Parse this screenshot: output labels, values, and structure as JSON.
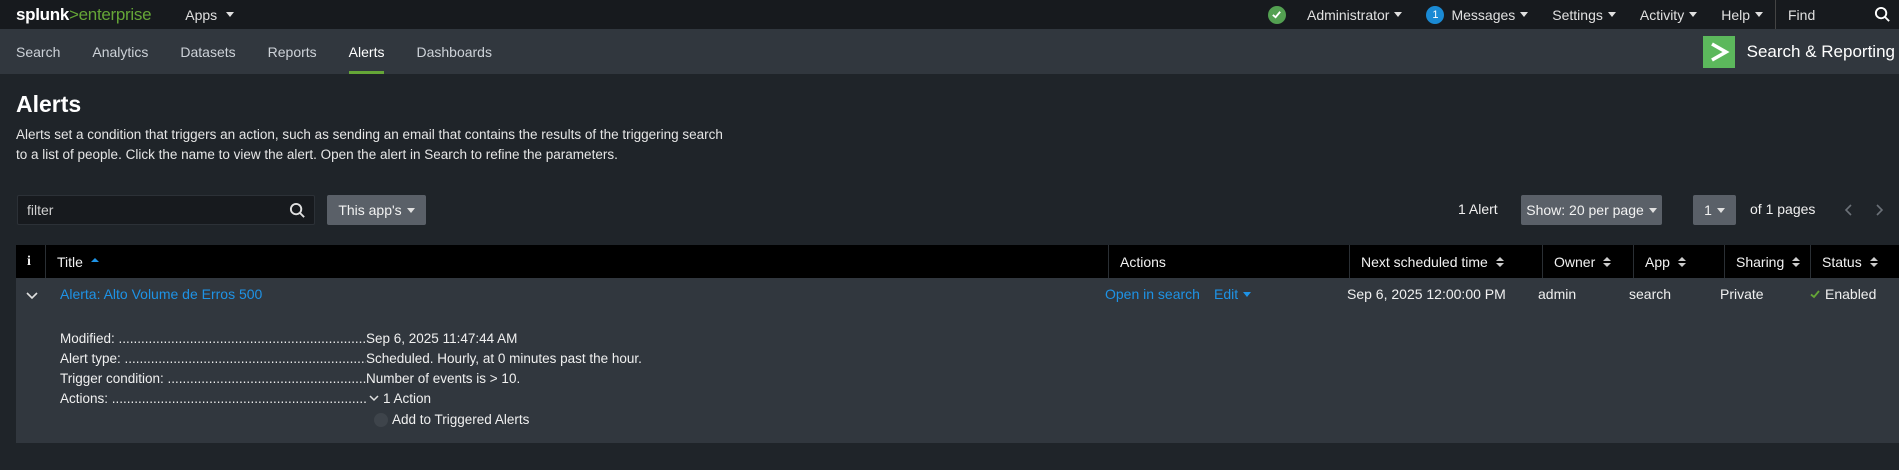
{
  "topbar": {
    "logo_main": "splunk",
    "logo_gt": ">",
    "logo_suffix": "enterprise",
    "apps_label": "Apps",
    "admin_label": "Administrator",
    "messages_count": "1",
    "messages_label": "Messages",
    "settings_label": "Settings",
    "activity_label": "Activity",
    "help_label": "Help",
    "find_label": "Find"
  },
  "appbar": {
    "nav": [
      "Search",
      "Analytics",
      "Datasets",
      "Reports",
      "Alerts",
      "Dashboards"
    ],
    "app_title": "Search & Reporting"
  },
  "page": {
    "title": "Alerts",
    "description": "Alerts set a condition that triggers an action, such as sending an email that contains the results of the triggering search to a list of people. Click the name to view the alert. Open the alert in Search to refine the parameters."
  },
  "controls": {
    "filter_placeholder": "filter",
    "apps_button": "This app's",
    "alert_count": "1 Alert",
    "per_page": "Show: 20 per page",
    "page_number": "1",
    "of_pages": "of 1 pages"
  },
  "table": {
    "headers": {
      "info": "i",
      "title": "Title",
      "actions": "Actions",
      "next_time": "Next scheduled time",
      "owner": "Owner",
      "app": "App",
      "sharing": "Sharing",
      "status": "Status"
    },
    "row": {
      "title": "Alerta: Alto Volume de Erros 500",
      "open_in_search": "Open in search",
      "edit": "Edit",
      "next_time": "Sep 6, 2025 12:00:00 PM",
      "owner": "admin",
      "app": "search",
      "sharing": "Private",
      "status": "Enabled"
    },
    "details": {
      "modified_label": "Modified: ....................................................................................",
      "modified_value": "Sep 6, 2025 11:47:44 AM",
      "type_label": "Alert type: ........................................................................................",
      "type_value": "Scheduled. Hourly, at 0 minutes past the hour.",
      "trigger_label": "Trigger condition: ..................................................................................",
      "trigger_value": "Number of events is > 10.",
      "actions_label": "Actions: ...............................................................................................",
      "actions_value": "1 Action",
      "action_item": "Add to Triggered Alerts"
    }
  },
  "colors": {
    "accent_green": "#65a637",
    "link_blue": "#1e93e6"
  }
}
